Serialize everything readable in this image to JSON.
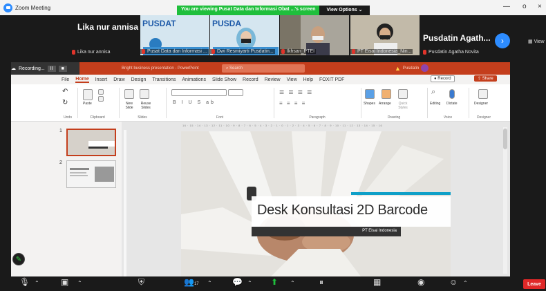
{
  "zoom": {
    "window_title": "Zoom Meeting",
    "banner_message": "You are viewing Pusat Data dan Informasi Obat ...'s screen",
    "view_options": "View Options",
    "side_view": "View",
    "controls": {
      "minimize": "—",
      "restore": "o",
      "close": "×"
    }
  },
  "participants": [
    {
      "name": "Lika nur annisa",
      "sub": "Lika nur annisa"
    },
    {
      "label": "Pusat Data dan Informasi ..."
    },
    {
      "label": "Dwi Resmiyarti Pusdatin..."
    },
    {
      "label": "Ikhsan_PTEI"
    },
    {
      "label": "PT Eisai Indonesia_Nin..."
    },
    {
      "name": "Pusdatin  Agath...",
      "sub": "Pusdatin Agatha Novita"
    }
  ],
  "recording": {
    "label": "Recording...",
    "pause": "II",
    "stop": "■"
  },
  "ppt": {
    "doc_title": "Bright business presentation - PowerPoint",
    "search_placeholder": "Search",
    "user": "Pusdatin",
    "tabs": [
      "File",
      "Home",
      "Insert",
      "Draw",
      "Design",
      "Transitions",
      "Animations",
      "Slide Show",
      "Record",
      "Review",
      "View",
      "Help",
      "FOXIT PDF"
    ],
    "active_tab": "Home",
    "record_btn": "Record",
    "share_btn": "Share",
    "ribbon_groups": [
      "Undo",
      "Clipboard",
      "Slides",
      "Font",
      "Paragraph",
      "Drawing",
      "Voice",
      "Designer"
    ],
    "ribbon_labels": {
      "paste": "Paste",
      "new_slide": "New Slide",
      "reuse_slides": "Reuse Slides",
      "shapes": "Shapes",
      "arrange": "Arrange",
      "quick_styles": "Quick Styles",
      "editing": "Editing",
      "dictate": "Dictate",
      "designer": "Designer"
    },
    "slide_numbers": [
      "1",
      "2"
    ],
    "ruler": "16 · 15 · 14 · 13 · 12 · 11 · 10 · 9 · 8 · 7 · 6 · 5 · 4 · 3 · 2 · 1 · 0 · 1 · 2 · 3 · 4 · 5 · 6 · 7 · 8 · 9 · 10 · 11 · 12 · 13 · 14 · 15 · 16"
  },
  "slide": {
    "title": "Desk Konsultasi 2D Barcode",
    "subtitle": "PT Eisai Indonesia",
    "accent_color": "#0fa0c8"
  },
  "toolbar": {
    "leave": "Leave",
    "participants_count": "17"
  },
  "colors": {
    "ppt_red": "#c43e1c",
    "zoom_blue": "#2d8cff",
    "banner_green": "#1fbf3c",
    "leave_red": "#e02828"
  }
}
